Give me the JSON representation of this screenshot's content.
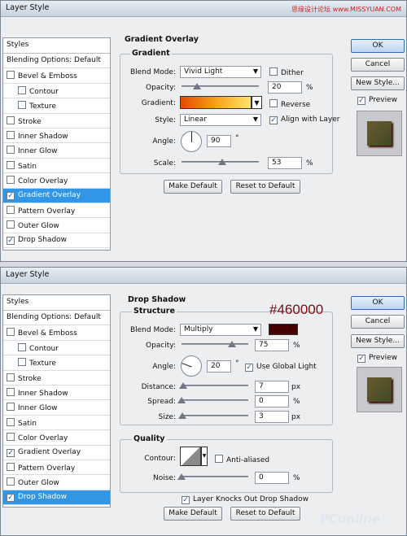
{
  "watermark": "思缘设计论坛 www.MISSYUAN.COM",
  "dialog1": {
    "title": "Layer Style",
    "styles_header": "Styles",
    "blending": "Blending Options: Default",
    "items": [
      {
        "label": "Bevel & Emboss",
        "checked": false,
        "indent": false,
        "selected": false
      },
      {
        "label": "Contour",
        "checked": false,
        "indent": true,
        "selected": false
      },
      {
        "label": "Texture",
        "checked": false,
        "indent": true,
        "selected": false
      },
      {
        "label": "Stroke",
        "checked": false,
        "indent": false,
        "selected": false
      },
      {
        "label": "Inner Shadow",
        "checked": false,
        "indent": false,
        "selected": false
      },
      {
        "label": "Inner Glow",
        "checked": false,
        "indent": false,
        "selected": false
      },
      {
        "label": "Satin",
        "checked": false,
        "indent": false,
        "selected": false
      },
      {
        "label": "Color Overlay",
        "checked": false,
        "indent": false,
        "selected": false
      },
      {
        "label": "Gradient Overlay",
        "checked": true,
        "indent": false,
        "selected": true
      },
      {
        "label": "Pattern Overlay",
        "checked": false,
        "indent": false,
        "selected": false
      },
      {
        "label": "Outer Glow",
        "checked": false,
        "indent": false,
        "selected": false
      },
      {
        "label": "Drop Shadow",
        "checked": true,
        "indent": false,
        "selected": false
      }
    ],
    "section": "Gradient Overlay",
    "group": "Gradient",
    "blend_mode_label": "Blend Mode:",
    "blend_mode": "Vivid Light",
    "dither": "Dither",
    "opacity_label": "Opacity:",
    "opacity": "20",
    "opacity_level": 0.2,
    "percent": "%",
    "gradient_label": "Gradient:",
    "reverse": "Reverse",
    "style_label": "Style:",
    "style": "Linear",
    "align": "Align with Layer",
    "angle_label": "Angle:",
    "angle": "90",
    "degree": "°",
    "scale_label": "Scale:",
    "scale": "53",
    "scale_level": 0.53,
    "make_default": "Make Default",
    "reset_default": "Reset to Default",
    "ok": "OK",
    "cancel": "Cancel",
    "new_style": "New Style...",
    "preview": "Preview"
  },
  "dialog2": {
    "title": "Layer Style",
    "styles_header": "Styles",
    "blending": "Blending Options: Default",
    "items": [
      {
        "label": "Bevel & Emboss",
        "checked": false,
        "indent": false,
        "selected": false
      },
      {
        "label": "Contour",
        "checked": false,
        "indent": true,
        "selected": false
      },
      {
        "label": "Texture",
        "checked": false,
        "indent": true,
        "selected": false
      },
      {
        "label": "Stroke",
        "checked": false,
        "indent": false,
        "selected": false
      },
      {
        "label": "Inner Shadow",
        "checked": false,
        "indent": false,
        "selected": false
      },
      {
        "label": "Inner Glow",
        "checked": false,
        "indent": false,
        "selected": false
      },
      {
        "label": "Satin",
        "checked": false,
        "indent": false,
        "selected": false
      },
      {
        "label": "Color Overlay",
        "checked": false,
        "indent": false,
        "selected": false
      },
      {
        "label": "Gradient Overlay",
        "checked": true,
        "indent": false,
        "selected": false
      },
      {
        "label": "Pattern Overlay",
        "checked": false,
        "indent": false,
        "selected": false
      },
      {
        "label": "Outer Glow",
        "checked": false,
        "indent": false,
        "selected": false
      },
      {
        "label": "Drop Shadow",
        "checked": true,
        "indent": false,
        "selected": true
      }
    ],
    "section": "Drop Shadow",
    "group": "Structure",
    "hex_annotation": "#460000",
    "shadow_color": "#460000",
    "blend_mode_label": "Blend Mode:",
    "blend_mode": "Multiply",
    "opacity_label": "Opacity:",
    "opacity": "75",
    "opacity_level": 0.75,
    "percent": "%",
    "angle_label": "Angle:",
    "angle": "20",
    "degree": "°",
    "global_light": "Use Global Light",
    "distance_label": "Distance:",
    "distance": "7",
    "distance_level": 0.03,
    "spread_label": "Spread:",
    "spread": "0",
    "spread_level": 0,
    "size_label": "Size:",
    "size": "3",
    "size_level": 0.01,
    "px": "px",
    "quality_group": "Quality",
    "contour_label": "Contour:",
    "anti_aliased": "Anti-aliased",
    "noise_label": "Noise:",
    "noise": "0",
    "noise_level": 0,
    "knockout": "Layer Knocks Out Drop Shadow",
    "make_default": "Make Default",
    "reset_default": "Reset to Default",
    "ok": "OK",
    "cancel": "Cancel",
    "new_style": "New Style...",
    "preview": "Preview"
  },
  "bottom_watermark": "PConline"
}
